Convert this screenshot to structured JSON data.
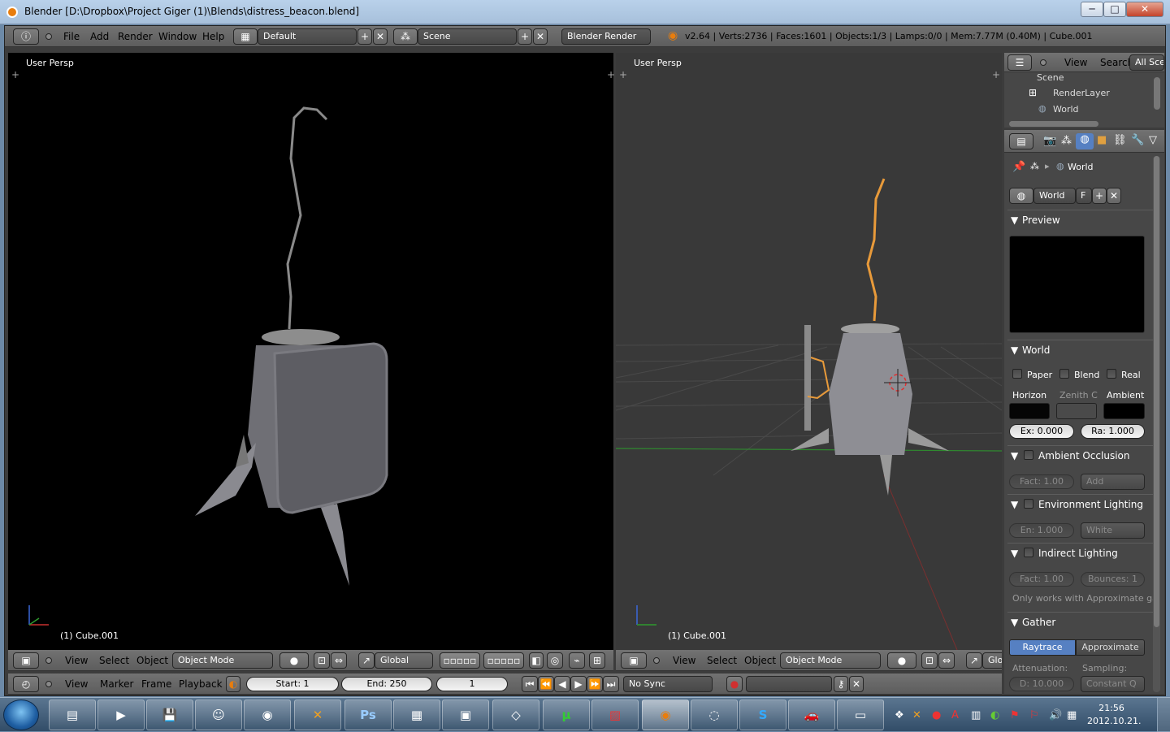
{
  "window": {
    "title": "Blender [D:\\Dropbox\\Project Giger (1)\\Blends\\distress_beacon.blend]",
    "min": "─",
    "max": "□",
    "close": "✕"
  },
  "info_header": {
    "menus": [
      "File",
      "Add",
      "Render",
      "Window",
      "Help"
    ],
    "layout": "Default",
    "scene": "Scene",
    "engine": "Blender Render",
    "stats": "v2.64 | Verts:2736 | Faces:1601 | Objects:1/3 | Lamps:0/0 | Mem:7.77M (0.40M) | Cube.001"
  },
  "viewport_left": {
    "label": "User Persp",
    "object": "(1) Cube.001"
  },
  "viewport_right": {
    "label": "User Persp",
    "object": "(1) Cube.001"
  },
  "view3d_header": {
    "menus": [
      "View",
      "Select",
      "Object"
    ],
    "mode": "Object Mode",
    "orientation": "Global",
    "orientation_short": "Glo"
  },
  "timeline": {
    "menus": [
      "View",
      "Marker",
      "Frame",
      "Playback"
    ],
    "start": "Start: 1",
    "end": "End: 250",
    "frame": "1",
    "sync": "No Sync"
  },
  "outliner": {
    "menus": [
      "View",
      "Search"
    ],
    "filter": "All Scen",
    "items": [
      "Scene",
      "RenderLayer",
      "World"
    ]
  },
  "properties": {
    "breadcrumb": "World",
    "world_name": "World",
    "fake_user": "F",
    "preview": {
      "title": "Preview"
    },
    "world_panel": {
      "title": "World",
      "checks": [
        "Paper",
        "Blend",
        "Real"
      ],
      "horizon": "Horizon",
      "zenith": "Zenith C",
      "ambient": "Ambient",
      "exposure": "Ex: 0.000",
      "range": "Ra: 1.000",
      "colors": {
        "horizon": "#050505",
        "zenith": "#4a4a4a",
        "ambient": "#000000"
      }
    },
    "ao_panel": {
      "title": "Ambient Occlusion",
      "factor": "Fact: 1.00",
      "blend": "Add"
    },
    "env_panel": {
      "title": "Environment Lighting",
      "energy": "En: 1.000",
      "color": "White"
    },
    "indirect_panel": {
      "title": "Indirect Lighting",
      "factor": "Fact: 1.00",
      "bounces": "Bounces: 1",
      "note": "Only works with Approximate ga"
    },
    "gather_panel": {
      "title": "Gather",
      "raytrace": "Raytrace",
      "approximate": "Approximate",
      "attenuation": "Attenuation:",
      "sampling": "Sampling:",
      "distance": "D: 10.000",
      "sampling_value": "Constant Q"
    }
  },
  "taskbar": {
    "apps": [
      "Windows Explorer",
      "Media Player",
      "Save",
      "Messenger",
      "Chrome",
      "Chat",
      "Photoshop",
      "Calculator",
      "Console",
      "Unity",
      "uTorrent",
      "App",
      "Blender",
      "Loading",
      "Skype",
      "Car",
      "Photos"
    ],
    "clock_time": "21:56",
    "clock_date": "2012.10.21."
  },
  "colors": {
    "selection": "#e89a3a",
    "active_button": "#5680c2",
    "blender_orange": "#e87d0d"
  }
}
